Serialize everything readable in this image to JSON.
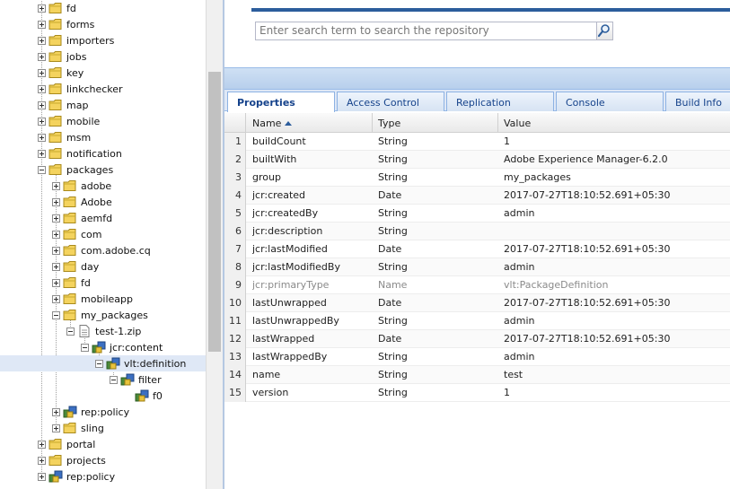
{
  "tree": {
    "nodes": [
      {
        "label": "fd",
        "level": 0,
        "expander": "plus",
        "icon": "folder"
      },
      {
        "label": "forms",
        "level": 0,
        "expander": "plus",
        "icon": "folder"
      },
      {
        "label": "importers",
        "level": 0,
        "expander": "plus",
        "icon": "folder"
      },
      {
        "label": "jobs",
        "level": 0,
        "expander": "plus",
        "icon": "folder"
      },
      {
        "label": "key",
        "level": 0,
        "expander": "plus",
        "icon": "folder"
      },
      {
        "label": "linkchecker",
        "level": 0,
        "expander": "plus",
        "icon": "folder"
      },
      {
        "label": "map",
        "level": 0,
        "expander": "plus",
        "icon": "folder"
      },
      {
        "label": "mobile",
        "level": 0,
        "expander": "plus",
        "icon": "folder"
      },
      {
        "label": "msm",
        "level": 0,
        "expander": "plus",
        "icon": "folder"
      },
      {
        "label": "notification",
        "level": 0,
        "expander": "plus",
        "icon": "folder"
      },
      {
        "label": "packages",
        "level": 0,
        "expander": "minus",
        "icon": "folder"
      },
      {
        "label": "adobe",
        "level": 1,
        "expander": "plus",
        "icon": "folder"
      },
      {
        "label": "Adobe",
        "level": 1,
        "expander": "plus",
        "icon": "folder"
      },
      {
        "label": "aemfd",
        "level": 1,
        "expander": "plus",
        "icon": "folder"
      },
      {
        "label": "com",
        "level": 1,
        "expander": "plus",
        "icon": "folder"
      },
      {
        "label": "com.adobe.cq",
        "level": 1,
        "expander": "plus",
        "icon": "folder"
      },
      {
        "label": "day",
        "level": 1,
        "expander": "plus",
        "icon": "folder"
      },
      {
        "label": "fd",
        "level": 1,
        "expander": "plus",
        "icon": "folder"
      },
      {
        "label": "mobileapp",
        "level": 1,
        "expander": "plus",
        "icon": "folder"
      },
      {
        "label": "my_packages",
        "level": 1,
        "expander": "minus",
        "icon": "folder"
      },
      {
        "label": "test-1.zip",
        "level": 2,
        "expander": "minus",
        "icon": "file"
      },
      {
        "label": "jcr:content",
        "level": 3,
        "expander": "minus",
        "icon": "node"
      },
      {
        "label": "vlt:definition",
        "level": 4,
        "expander": "minus",
        "icon": "node",
        "selected": true
      },
      {
        "label": "filter",
        "level": 5,
        "expander": "minus",
        "icon": "node"
      },
      {
        "label": "f0",
        "level": 6,
        "expander": "none",
        "icon": "node"
      },
      {
        "label": "rep:policy",
        "level": 1,
        "expander": "plus",
        "icon": "node"
      },
      {
        "label": "sling",
        "level": 1,
        "expander": "plus",
        "icon": "folder"
      },
      {
        "label": "portal",
        "level": 0,
        "expander": "plus",
        "icon": "folder"
      },
      {
        "label": "projects",
        "level": 0,
        "expander": "plus",
        "icon": "folder"
      },
      {
        "label": "rep:policy",
        "level": 0,
        "expander": "plus",
        "icon": "node"
      }
    ]
  },
  "search": {
    "placeholder": "Enter search term to search the repository",
    "button_icon": "search-icon"
  },
  "tabs": [
    {
      "label": "Properties",
      "active": true
    },
    {
      "label": "Access Control"
    },
    {
      "label": "Replication"
    },
    {
      "label": "Console"
    },
    {
      "label": "Build Info"
    }
  ],
  "grid": {
    "columns": {
      "name": "Name",
      "type": "Type",
      "value": "Value"
    },
    "rows": [
      {
        "num": "1",
        "name": "buildCount",
        "type": "String",
        "value": "1"
      },
      {
        "num": "2",
        "name": "builtWith",
        "type": "String",
        "value": "Adobe Experience Manager-6.2.0"
      },
      {
        "num": "3",
        "name": "group",
        "type": "String",
        "value": "my_packages"
      },
      {
        "num": "4",
        "name": "jcr:created",
        "type": "Date",
        "value": "2017-07-27T18:10:52.691+05:30"
      },
      {
        "num": "5",
        "name": "jcr:createdBy",
        "type": "String",
        "value": "admin"
      },
      {
        "num": "6",
        "name": "jcr:description",
        "type": "String",
        "value": ""
      },
      {
        "num": "7",
        "name": "jcr:lastModified",
        "type": "Date",
        "value": "2017-07-27T18:10:52.691+05:30"
      },
      {
        "num": "8",
        "name": "jcr:lastModifiedBy",
        "type": "String",
        "value": "admin"
      },
      {
        "num": "9",
        "name": "jcr:primaryType",
        "type": "Name",
        "value": "vlt:PackageDefinition",
        "muted": true
      },
      {
        "num": "10",
        "name": "lastUnwrapped",
        "type": "Date",
        "value": "2017-07-27T18:10:52.691+05:30"
      },
      {
        "num": "11",
        "name": "lastUnwrappedBy",
        "type": "String",
        "value": "admin"
      },
      {
        "num": "12",
        "name": "lastWrapped",
        "type": "Date",
        "value": "2017-07-27T18:10:52.691+05:30"
      },
      {
        "num": "13",
        "name": "lastWrappedBy",
        "type": "String",
        "value": "admin"
      },
      {
        "num": "14",
        "name": "name",
        "type": "String",
        "value": "test"
      },
      {
        "num": "15",
        "name": "version",
        "type": "String",
        "value": "1"
      }
    ]
  },
  "colors": {
    "accent": "#2c5d9c",
    "tab_text": "#15428b",
    "selection": "#dfe8f6"
  }
}
